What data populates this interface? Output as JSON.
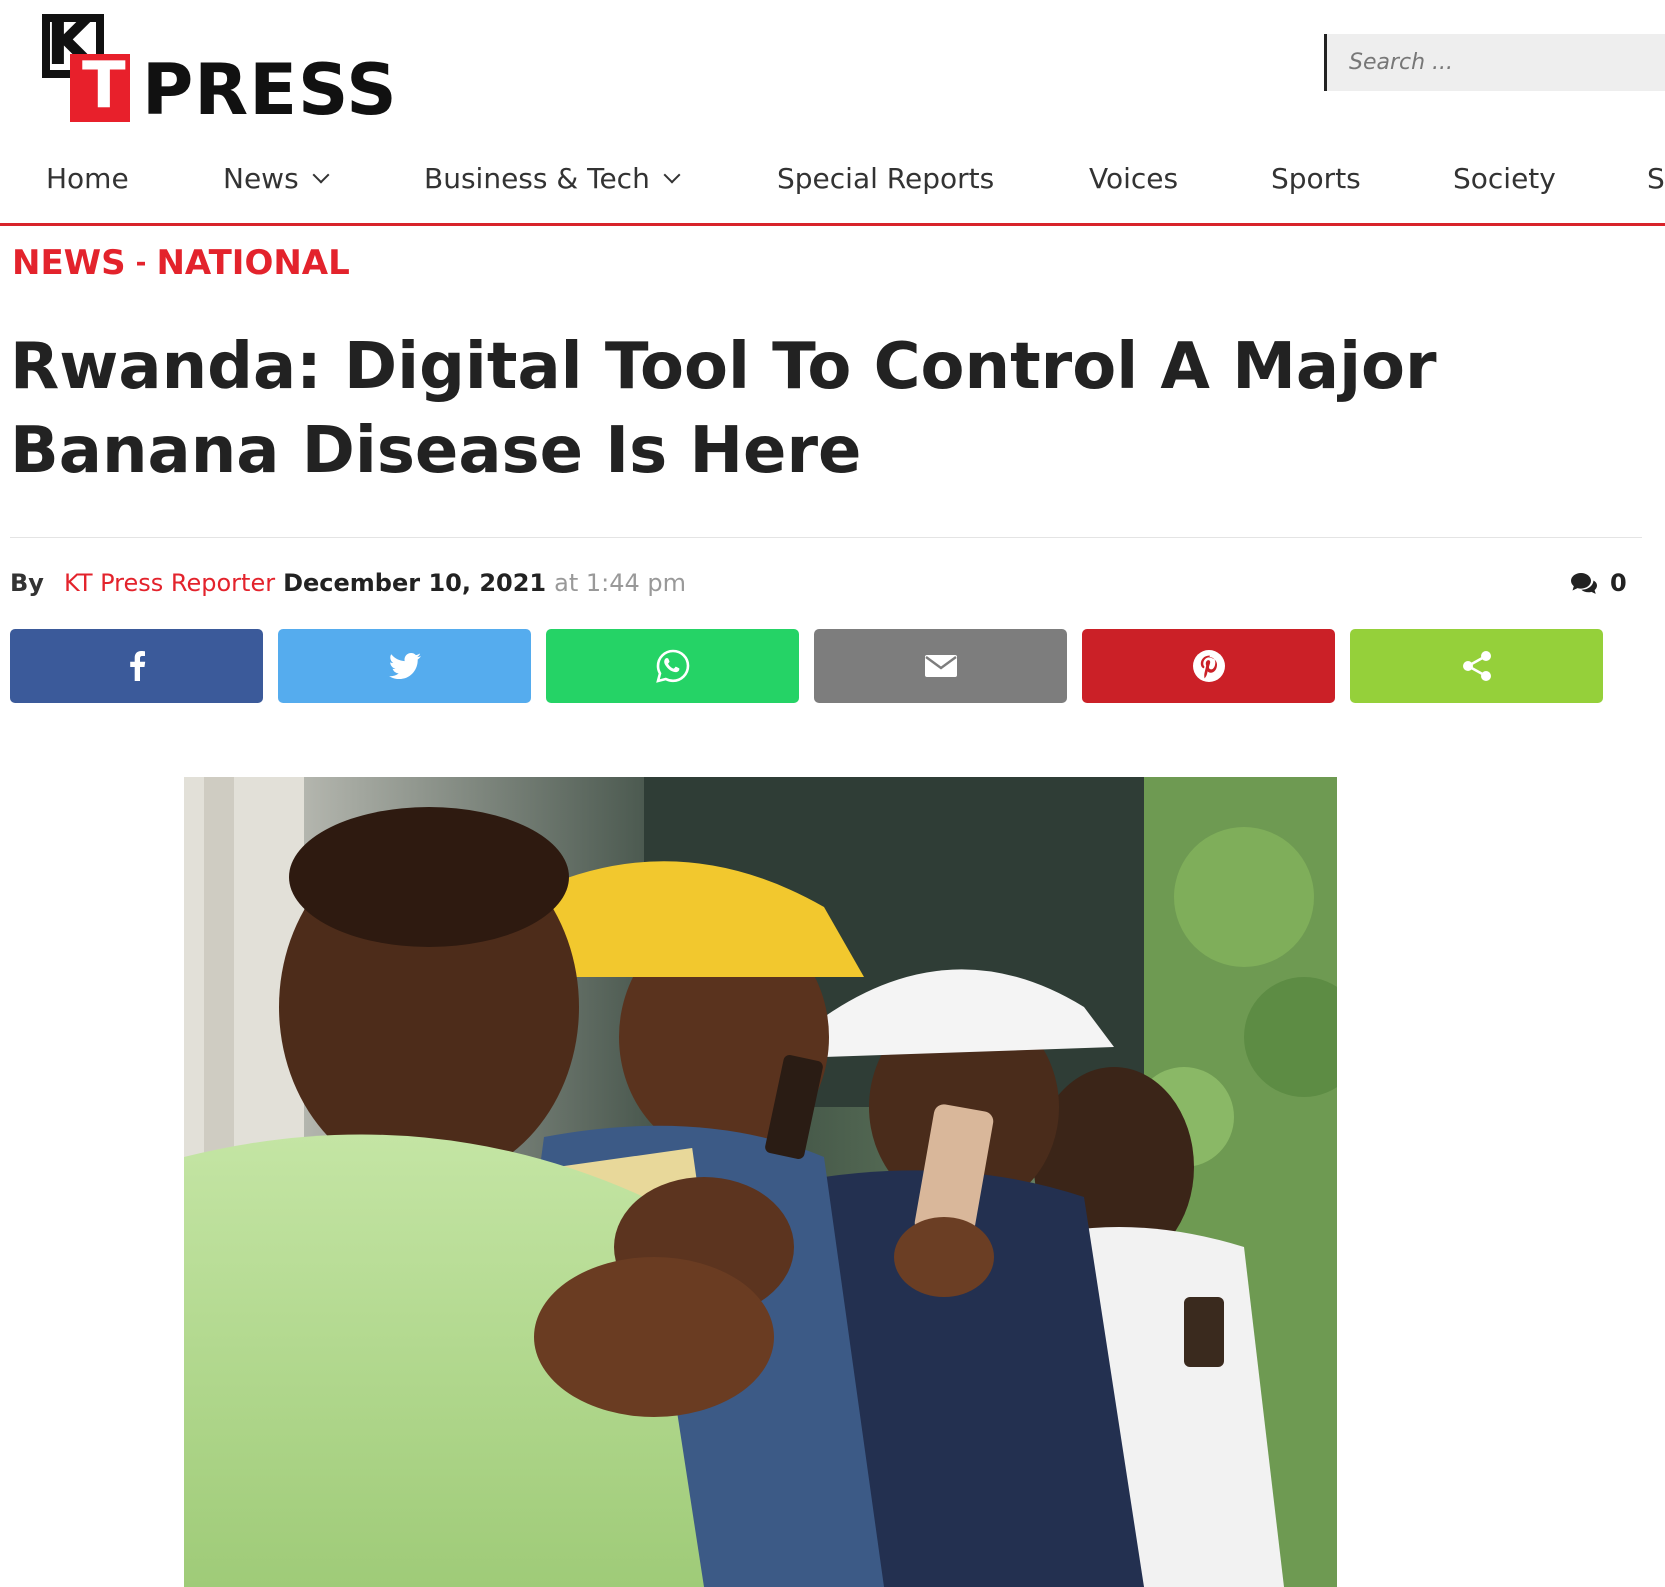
{
  "site": {
    "logo_top": "KT",
    "logo_word": "PRESS"
  },
  "search": {
    "placeholder": "Search ..."
  },
  "nav": {
    "items": [
      {
        "label": "Home",
        "has_dropdown": false
      },
      {
        "label": "News",
        "has_dropdown": true
      },
      {
        "label": "Business & Tech",
        "has_dropdown": true
      },
      {
        "label": "Special Reports",
        "has_dropdown": false
      },
      {
        "label": "Voices",
        "has_dropdown": false
      },
      {
        "label": "Sports",
        "has_dropdown": false
      },
      {
        "label": "Society",
        "has_dropdown": false
      },
      {
        "label": "S",
        "has_dropdown": false
      }
    ]
  },
  "breadcrumb": {
    "category": "NEWS",
    "separator": "-",
    "subcategory": "NATIONAL"
  },
  "article": {
    "title": "Rwanda: Digital Tool To Control A Major Banana Disease Is Here",
    "by_label": "By",
    "author": "KT Press Reporter",
    "date": "December 10, 2021",
    "time": "at 1:44 pm",
    "comment_count": "0"
  },
  "share": {
    "buttons": [
      {
        "name": "facebook",
        "icon": "facebook-icon",
        "color": "#3b5a9a"
      },
      {
        "name": "twitter",
        "icon": "twitter-icon",
        "color": "#55acee"
      },
      {
        "name": "whatsapp",
        "icon": "whatsapp-icon",
        "color": "#25d366"
      },
      {
        "name": "email",
        "icon": "email-icon",
        "color": "#7d7d7d"
      },
      {
        "name": "pinterest",
        "icon": "pinterest-icon",
        "color": "#cb2027"
      },
      {
        "name": "share",
        "icon": "share-icon",
        "color": "#95d03a"
      }
    ]
  },
  "colors": {
    "accent_red": "#e3232c",
    "nav_border": "#d8232a",
    "text_dark": "#222222"
  }
}
